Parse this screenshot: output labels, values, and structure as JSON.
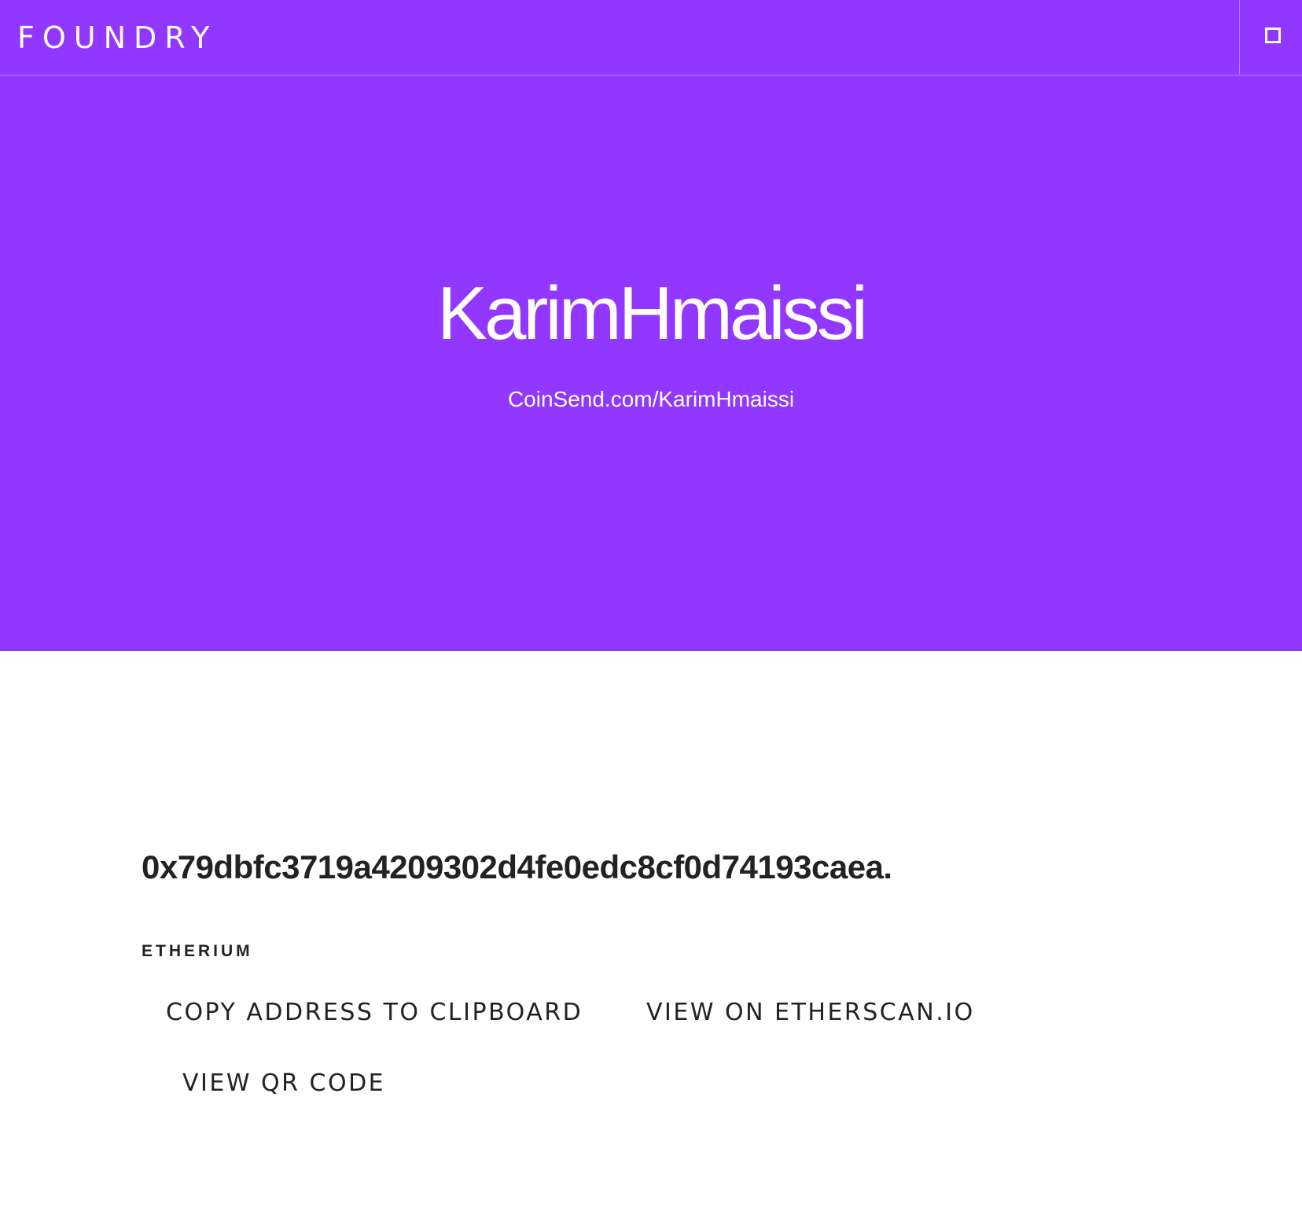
{
  "header": {
    "brand": "FOUNDRY",
    "menu_icon": "square-icon"
  },
  "hero": {
    "name": "KarimHmaissi",
    "link": "CoinSend.com/KarimHmaissi",
    "background": "#9137ff"
  },
  "wallet": {
    "address": "0x79dbfc3719a4209302d4fe0edc8cf0d74193caea.",
    "coin": "ETHERIUM",
    "actions": {
      "copy": "COPY ADDRESS TO CLIPBOARD",
      "etherscan": "VIEW ON ETHERSCAN.IO",
      "qr": "VIEW QR CODE"
    }
  }
}
